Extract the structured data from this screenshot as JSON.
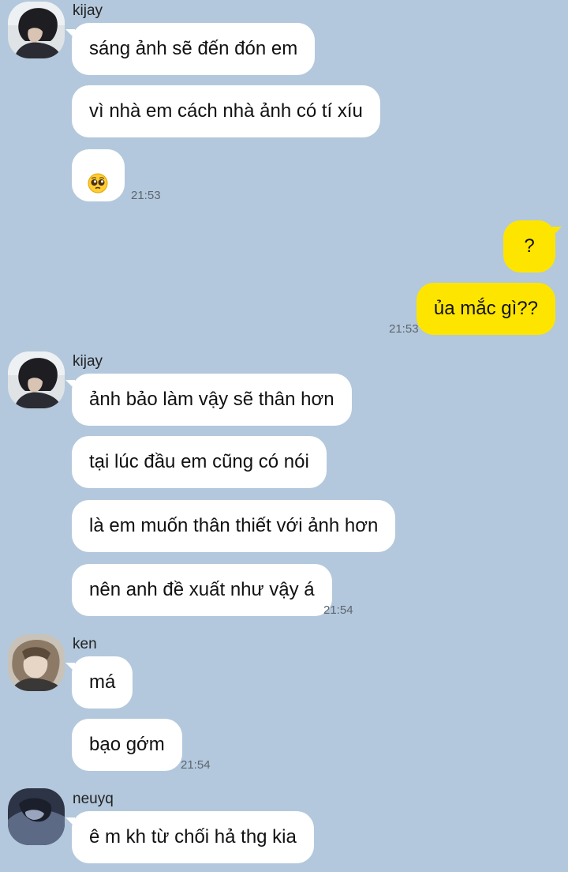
{
  "colors": {
    "background": "#b3c8dc",
    "incoming_bubble": "#ffffff",
    "outgoing_bubble": "#fee500"
  },
  "messages": [
    {
      "sender": "kijay",
      "direction": "in",
      "text": "sáng ảnh sẽ đến đón em"
    },
    {
      "sender": "kijay",
      "direction": "in",
      "text": "vì nhà em cách nhà ảnh có tí xíu"
    },
    {
      "sender": "kijay",
      "direction": "in",
      "emoji": "pleading-face-emoji",
      "time": "21:53"
    },
    {
      "sender": "me",
      "direction": "out",
      "text": "?"
    },
    {
      "sender": "me",
      "direction": "out",
      "text": "ủa mắc gì??",
      "time": "21:53"
    },
    {
      "sender": "kijay",
      "direction": "in",
      "text": "ảnh bảo làm vậy sẽ thân hơn"
    },
    {
      "sender": "kijay",
      "direction": "in",
      "text": "tại lúc đầu em cũng có nói"
    },
    {
      "sender": "kijay",
      "direction": "in",
      "text": "là em muốn thân thiết với ảnh hơn"
    },
    {
      "sender": "kijay",
      "direction": "in",
      "text": "nên anh đề xuất như vậy á",
      "time": "21:54"
    },
    {
      "sender": "ken",
      "direction": "in",
      "text": "má"
    },
    {
      "sender": "ken",
      "direction": "in",
      "text": "bạo gớm",
      "time": "21:54"
    },
    {
      "sender": "neuyq",
      "direction": "in",
      "text": "ê m kh từ chối hả thg kia"
    }
  ],
  "groups": [
    {
      "sender": "kijay",
      "avatar": "kijay-avatar"
    },
    {
      "sender": "kijay",
      "avatar": "kijay-avatar"
    },
    {
      "sender": "ken",
      "avatar": "ken-avatar"
    },
    {
      "sender": "neuyq",
      "avatar": "neuyq-avatar"
    }
  ]
}
